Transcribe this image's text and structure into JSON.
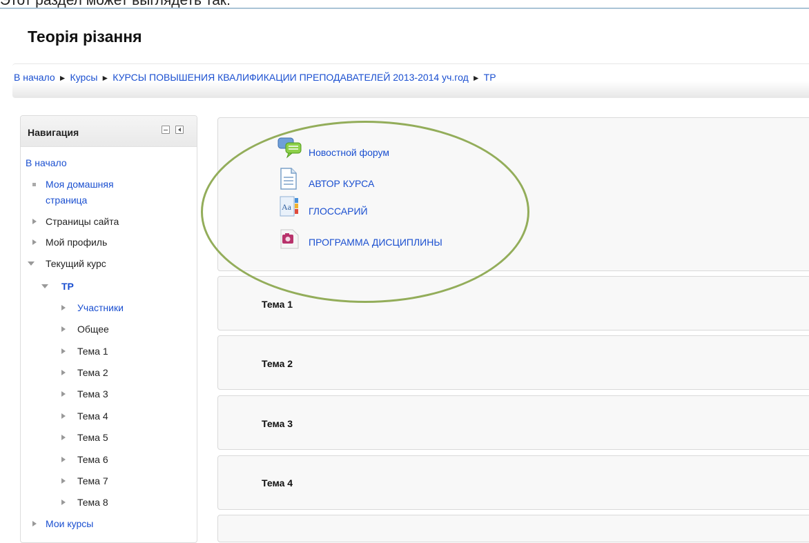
{
  "caption": "Этот раздел может выглядеть так:",
  "page_title": "Теорія різання",
  "breadcrumb": [
    "В начало",
    "Курсы",
    "КУРСЫ ПОВЫШЕНИЯ КВАЛИФИКАЦИИ ПРЕПОДАВАТЕЛЕЙ 2013-2014 уч.год",
    "ТР"
  ],
  "breadcrumb_separator": "►",
  "navigation": {
    "title": "Навигация",
    "home": "В начало",
    "items": [
      "Моя домашняя страница",
      "Страницы сайта",
      "Мой профиль",
      "Текущий курс",
      "ТР",
      "Участники",
      "Общее",
      "Тема 1",
      "Тема 2",
      "Тема 3",
      "Тема 4",
      "Тема 5",
      "Тема 6",
      "Тема 7",
      "Тема 8",
      "Мои курсы"
    ],
    "home_page_line1": "Моя домашняя",
    "home_page_line2": "страница"
  },
  "activities": [
    {
      "label": "Новостной форум",
      "icon": "forum-icon"
    },
    {
      "label": "АВТОР КУРСА",
      "icon": "page-icon"
    },
    {
      "label": "ГЛОССАРИЙ",
      "icon": "glossary-icon"
    },
    {
      "label": "ПРОГРАММА ДИСЦИПЛИНЫ",
      "icon": "file-icon"
    }
  ],
  "sections": [
    "Тема 1",
    "Тема 2",
    "Тема 3",
    "Тема 4"
  ],
  "colors": {
    "link": "#1a4fd0",
    "highlight_ellipse": "#93ad5a"
  }
}
